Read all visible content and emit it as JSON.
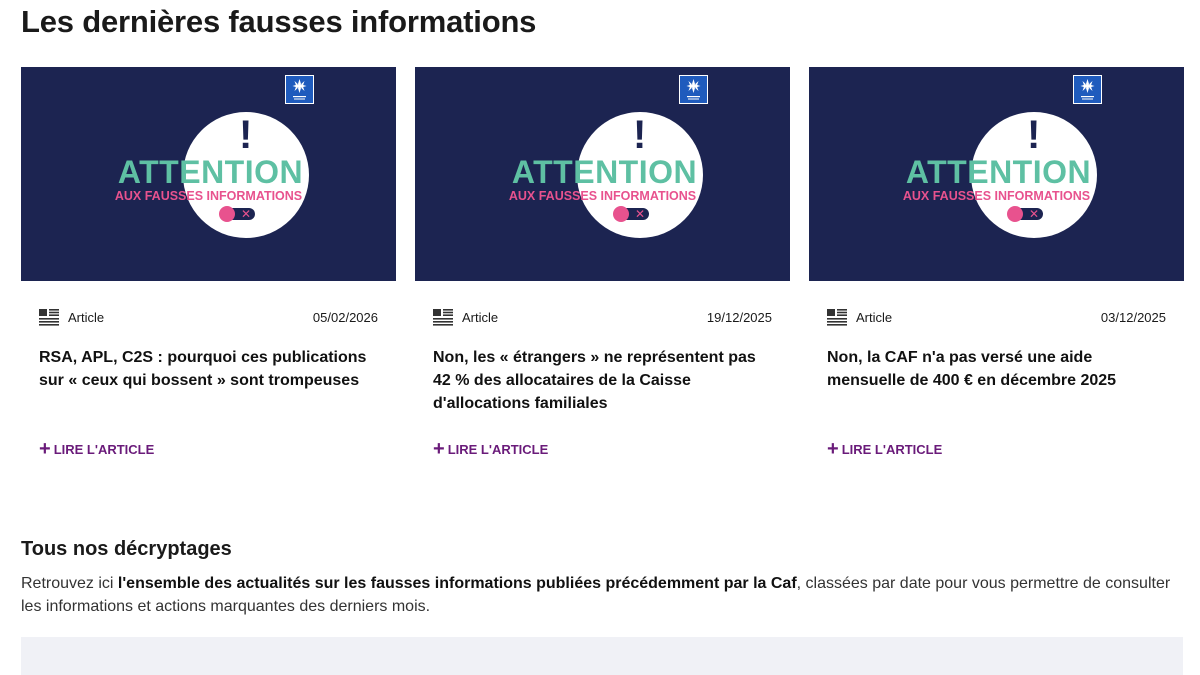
{
  "section": {
    "title": "Les dernières fausses informations"
  },
  "thumbnail": {
    "bang": "!",
    "headline": "ATTENTION",
    "subline": "AUX FAUSSES INFORMATIONS",
    "toggle_x": "✕",
    "colors": {
      "background": "#1c2451",
      "headline": "#5ec0a3",
      "subline": "#e8528e",
      "logo": "#1f5bbd"
    }
  },
  "cards": [
    {
      "type": "Article",
      "date": "05/02/2026",
      "title": "RSA, APL, C2S : pourquoi ces publications sur « ceux qui bossent » sont trompeuses",
      "read_more": "LIRE L'ARTICLE"
    },
    {
      "type": "Article",
      "date": "19/12/2025",
      "title": "Non, les « étrangers » ne représentent pas 42 % des allocataires de la Caisse d'allocations familiales",
      "read_more": "LIRE L'ARTICLE"
    },
    {
      "type": "Article",
      "date": "03/12/2025",
      "title": "Non, la CAF n'a pas versé une aide mensuelle de 400 € en décembre 2025",
      "read_more": "LIRE L'ARTICLE"
    }
  ],
  "decryptages": {
    "title": "Tous nos décryptages",
    "intro_prefix": "Retrouvez ici ",
    "intro_bold": "l'ensemble des actualités sur les fausses informations publiées précédemment par la Caf",
    "intro_suffix": ", classées par date pour vous permettre de consulter les informations et actions marquantes des derniers mois."
  },
  "accent_color": "#6a1b7a"
}
